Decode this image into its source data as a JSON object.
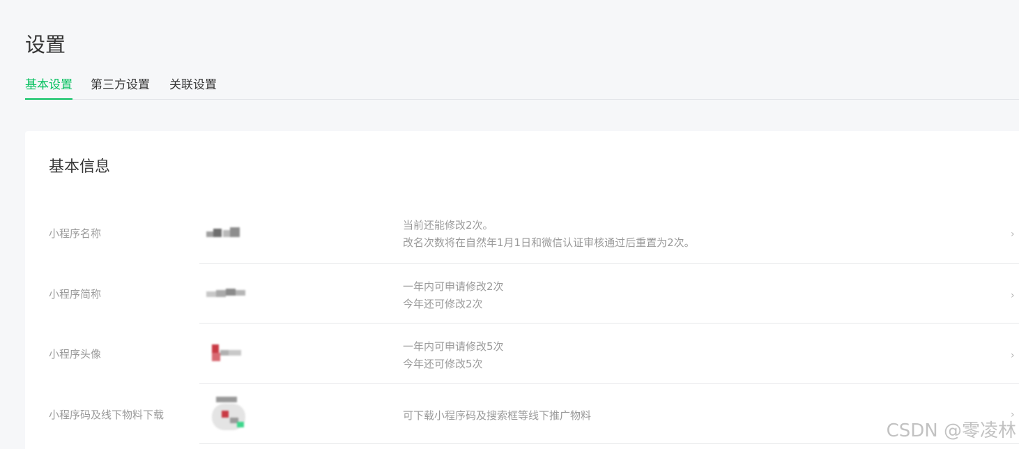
{
  "page": {
    "title": "设置"
  },
  "tabs": [
    {
      "label": "基本设置",
      "active": true
    },
    {
      "label": "第三方设置",
      "active": false
    },
    {
      "label": "关联设置",
      "active": false
    }
  ],
  "basic_info": {
    "title": "基本信息",
    "rows": [
      {
        "label": "小程序名称",
        "desc": [
          "当前还能修改2次。",
          "改名次数将在自然年1月1日和微信认证审核通过后重置为2次。"
        ]
      },
      {
        "label": "小程序简称",
        "desc": [
          "一年内可申请修改2次",
          "今年还可修改2次"
        ]
      },
      {
        "label": "小程序头像",
        "desc": [
          "一年内可申请修改5次",
          "今年还可修改5次"
        ]
      },
      {
        "label": "小程序码及线下物料下载",
        "desc": [
          "可下载小程序码及搜索框等线下推广物料"
        ]
      }
    ]
  },
  "colors": {
    "accent": "#07c160",
    "muted_text": "#9a9a9a",
    "background": "#f6f7f9"
  },
  "watermark": "CSDN @零凌林"
}
